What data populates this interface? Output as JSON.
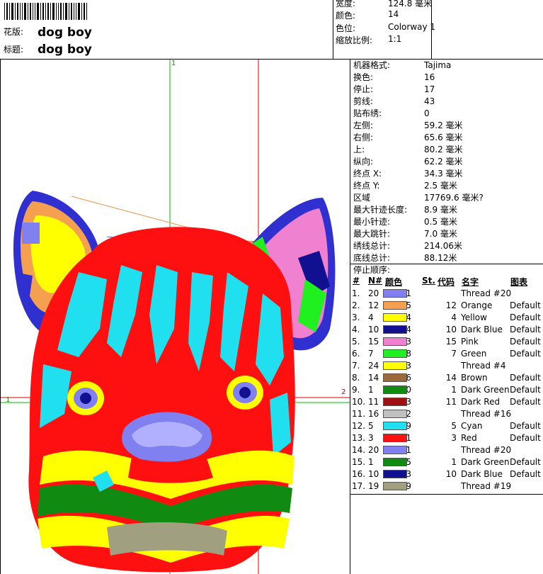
{
  "header": {
    "pattern_label": "花版:",
    "pattern_value": "dog boy",
    "title_label": "标题:",
    "title_value": "dog boy",
    "width_label": "宽度:",
    "width_value": "124.8 毫米",
    "colors_label": "颜色:",
    "colors_value": "14",
    "colorway_label": "色位:",
    "colorway_value": "Colorway 1",
    "scale_label": "缩放比例:",
    "scale_value": "1:1"
  },
  "canvas": {
    "marker_top": "1",
    "marker_left": "1",
    "marker_right": "2"
  },
  "info": [
    {
      "k": "机器格式:",
      "v": "Tajima"
    },
    {
      "k": "换色:",
      "v": "16"
    },
    {
      "k": "停止:",
      "v": "17"
    },
    {
      "k": "剪线:",
      "v": "43"
    },
    {
      "k": "贴布绣:",
      "v": "0"
    },
    {
      "k": "左侧:",
      "v": "59.2 毫米"
    },
    {
      "k": "右侧:",
      "v": "65.6 毫米"
    },
    {
      "k": "上:",
      "v": "80.2 毫米"
    },
    {
      "k": "纵向:",
      "v": "62.2 毫米"
    },
    {
      "k": "终点 X:",
      "v": "34.3 毫米"
    },
    {
      "k": "终点 Y:",
      "v": "2.5 毫米"
    },
    {
      "k": "区域",
      "v": "17769.6 毫米?"
    },
    {
      "k": "最大针迹长度:",
      "v": "8.9 毫米"
    },
    {
      "k": "最小针迹:",
      "v": "0.5 毫米"
    },
    {
      "k": "最大跳针:",
      "v": "7.0 毫米"
    },
    {
      "k": "绣线总计:",
      "v": "214.06米"
    },
    {
      "k": "底线总计:",
      "v": "88.12米"
    }
  ],
  "stop_sequence_label": "停止顺序:",
  "stop_table_headers": {
    "idx": "#",
    "n": "N#",
    "color": "颜色",
    "st": "St.",
    "code": "代码",
    "name": "名字",
    "chart": "图表"
  },
  "stops": [
    {
      "idx": "1.",
      "n": "20",
      "color": "#8080f0",
      "st": "9,371",
      "code": "",
      "name": "Thread #20",
      "chart": ""
    },
    {
      "idx": "2.",
      "n": "12",
      "color": "#f5a050",
      "st": "1,425",
      "code": "12",
      "name": "Orange",
      "chart": "Default"
    },
    {
      "idx": "3.",
      "n": "4",
      "color": "#ffff00",
      "st": "594",
      "code": "4",
      "name": "Yellow",
      "chart": "Default"
    },
    {
      "idx": "4.",
      "n": "10",
      "color": "#101090",
      "st": "964",
      "code": "10",
      "name": "Dark Blue",
      "chart": "Default"
    },
    {
      "idx": "5.",
      "n": "15",
      "color": "#f080d0",
      "st": "523",
      "code": "15",
      "name": "Pink",
      "chart": "Default"
    },
    {
      "idx": "6.",
      "n": "7",
      "color": "#20f020",
      "st": "458",
      "code": "7",
      "name": "Green",
      "chart": "Default"
    },
    {
      "idx": "7.",
      "n": "24",
      "color": "#ffff00",
      "st": "3,603",
      "code": "",
      "name": "Thread #4",
      "chart": ""
    },
    {
      "idx": "8.",
      "n": "14",
      "color": "#9c6a3a",
      "st": "836",
      "code": "14",
      "name": "Brown",
      "chart": "Default"
    },
    {
      "idx": "9.",
      "n": "1",
      "color": "#108a10",
      "st": "1,790",
      "code": "1",
      "name": "Dark Green",
      "chart": "Default"
    },
    {
      "idx": "10.",
      "n": "11",
      "color": "#a01010",
      "st": "1,163",
      "code": "11",
      "name": "Dark Red",
      "chart": "Default"
    },
    {
      "idx": "11.",
      "n": "16",
      "color": "#c0c0c0",
      "st": "722",
      "code": "",
      "name": "Thread #16",
      "chart": ""
    },
    {
      "idx": "12.",
      "n": "5",
      "color": "#20e0f0",
      "st": "4,269",
      "code": "5",
      "name": "Cyan",
      "chart": "Default"
    },
    {
      "idx": "13.",
      "n": "3",
      "color": "#ff1010",
      "st": "5,361",
      "code": "3",
      "name": "Red",
      "chart": "Default"
    },
    {
      "idx": "14.",
      "n": "20",
      "color": "#8080f0",
      "st": "321",
      "code": "",
      "name": "Thread #20",
      "chart": ""
    },
    {
      "idx": "15.",
      "n": "1",
      "color": "#108a10",
      "st": "145",
      "code": "1",
      "name": "Dark Green",
      "chart": "Default"
    },
    {
      "idx": "16.",
      "n": "10",
      "color": "#101090",
      "st": "183",
      "code": "10",
      "name": "Dark Blue",
      "chart": "Default"
    },
    {
      "idx": "17.",
      "n": "19",
      "color": "#a0a080",
      "st": "99",
      "code": "",
      "name": "Thread #19",
      "chart": ""
    }
  ]
}
